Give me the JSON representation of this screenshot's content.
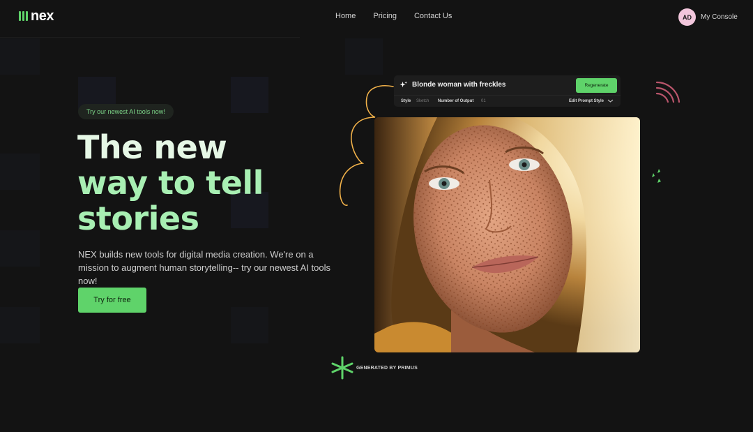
{
  "brand": {
    "name": "nex",
    "accent": "#5fd36a"
  },
  "nav": {
    "items": [
      {
        "label": "Home"
      },
      {
        "label": "Pricing"
      },
      {
        "label": "Contact Us"
      }
    ]
  },
  "account": {
    "initials": "AD",
    "console_label": "My Console"
  },
  "hero": {
    "badge": "Try our newest AI tools now!",
    "headline_1": "The new",
    "headline_2": "way to tell",
    "headline_3": "stories",
    "description": "NEX builds new tools for digital media creation. We're on a mission to augment human storytelling-- try our newest AI tools now!",
    "cta_label": "Try for free"
  },
  "prompt_panel": {
    "icon": "sparkle-icon",
    "prompt_text": "Blonde woman with freckles",
    "regenerate_label": "Regenerate",
    "style_label": "Style",
    "style_value": "Sketch",
    "outputs_label": "Number of Output",
    "outputs_value": "01",
    "edit_style_label": "Edit Prompt Style"
  },
  "generated_badge": {
    "icon": "asterisk-icon",
    "label": "GENERATED BY PRIMUS"
  }
}
